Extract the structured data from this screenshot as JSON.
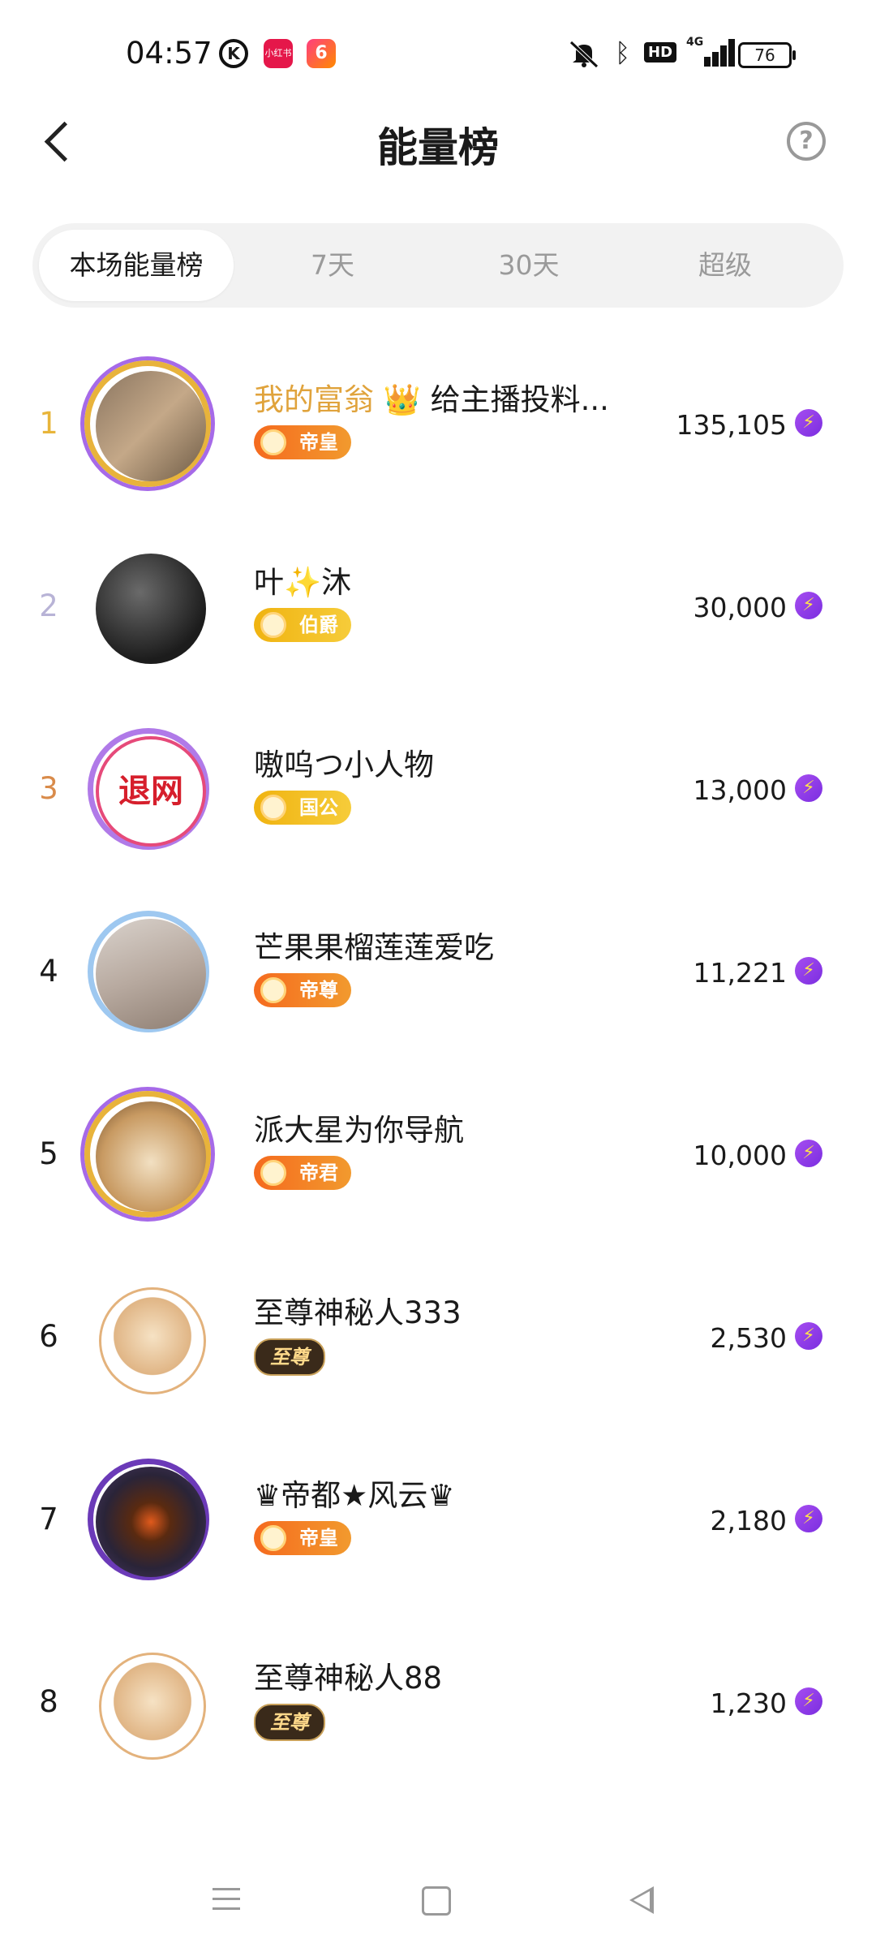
{
  "status_bar": {
    "time": "04:57",
    "app_k_letter": "K",
    "app_red_label": "小红书",
    "app_six_label": "6",
    "hd_label": "HD",
    "network_label": "4G",
    "battery": "76"
  },
  "header": {
    "title": "能量榜",
    "help_label": "?"
  },
  "tabs": [
    {
      "label": "本场能量榜",
      "active": true
    },
    {
      "label": "7天",
      "active": false
    },
    {
      "label": "30天",
      "active": false
    },
    {
      "label": "超级",
      "active": false
    }
  ],
  "ranking": [
    {
      "rank": "1",
      "name_prefix": "我的富翁",
      "crown": "👑",
      "name": " 给主播投料...",
      "badge": "帝皇",
      "score": "135,105"
    },
    {
      "rank": "2",
      "name": "叶✨沐",
      "badge": "伯爵",
      "score": "30,000"
    },
    {
      "rank": "3",
      "name": "嗷呜つ小人物",
      "badge": "国公",
      "score": "13,000",
      "avatar_text": "退网"
    },
    {
      "rank": "4",
      "name": "芒果果榴莲莲爱吃",
      "badge": "帝尊",
      "score": "11,221"
    },
    {
      "rank": "5",
      "name": "派大星为你导航",
      "badge": "帝君",
      "score": "10,000"
    },
    {
      "rank": "6",
      "name": "至尊神秘人333",
      "badge": "至尊",
      "score": "2,530"
    },
    {
      "rank": "7",
      "name": "♛帝都★风云♛",
      "badge": "帝皇",
      "score": "2,180"
    },
    {
      "rank": "8",
      "name": "至尊神秘人88",
      "badge": "至尊",
      "score": "1,230"
    }
  ],
  "colors": {
    "rank_1": "#e8b53a",
    "rank_2": "#b8b3d6",
    "rank_3": "#d98b4a",
    "rank_default": "#1a1a1a",
    "energy_bolt": "#8a3ce6"
  },
  "energy_icon": "lightning-bolt-icon"
}
